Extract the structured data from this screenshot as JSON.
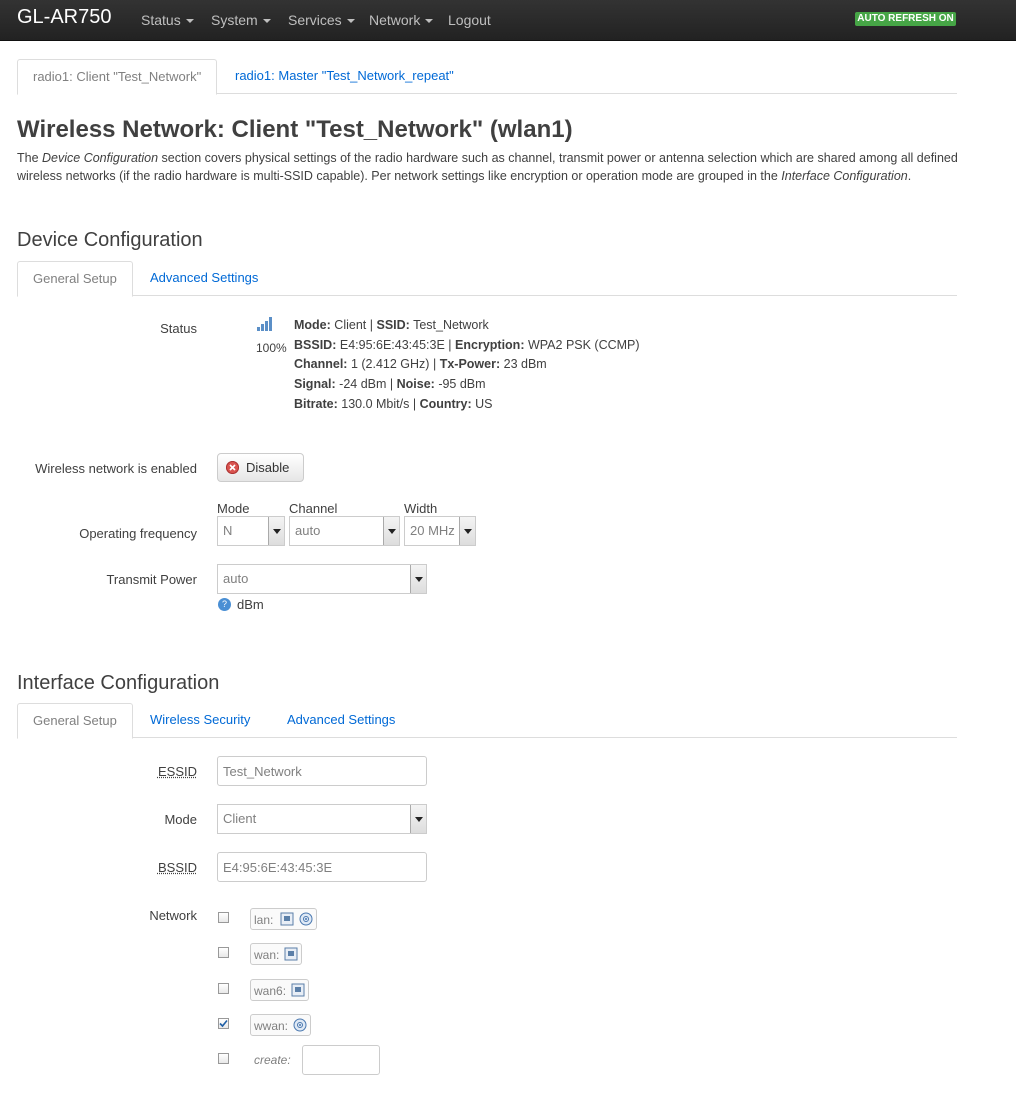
{
  "navbar": {
    "brand": "GL-AR750",
    "menu": [
      "Status",
      "System",
      "Services",
      "Network"
    ],
    "logout": "Logout",
    "auto_refresh": "AUTO REFRESH ON"
  },
  "top_tabs": [
    "radio1: Client \"Test_Network\"",
    "radio1: Master \"Test_Network_repeat\""
  ],
  "page": {
    "title": "Wireless Network: Client \"Test_Network\" (wlan1)",
    "desc_1": "The ",
    "desc_em1": "Device Configuration",
    "desc_2": " section covers physical settings of the radio hardware such as channel, transmit power or antenna selection which are shared among all defined wireless networks (if the radio hardware is multi-SSID capable). Per network settings like encryption or operation mode are grouped in the ",
    "desc_em2": "Interface Configuration",
    "desc_3": "."
  },
  "device_config": {
    "heading": "Device Configuration",
    "tabs": [
      "General Setup",
      "Advanced Settings"
    ],
    "status_label": "Status",
    "signal_percent": "100%",
    "status": {
      "mode_k": "Mode:",
      "mode_v": "Client",
      "ssid_k": "SSID:",
      "ssid_v": "Test_Network",
      "bssid_k": "BSSID:",
      "bssid_v": "E4:95:6E:43:45:3E",
      "enc_k": "Encryption:",
      "enc_v": "WPA2 PSK (CCMP)",
      "chan_k": "Channel:",
      "chan_v": "1 (2.412 GHz)",
      "txp_k": "Tx-Power:",
      "txp_v": "23 dBm",
      "sig_k": "Signal:",
      "sig_v": "-24 dBm",
      "noise_k": "Noise:",
      "noise_v": "-95 dBm",
      "bit_k": "Bitrate:",
      "bit_v": "130.0 Mbit/s",
      "country_k": "Country:",
      "country_v": "US",
      "sep": "|"
    },
    "enabled_label": "Wireless network is enabled",
    "disable_button": "Disable",
    "freq_label": "Operating frequency",
    "mode_label": "Mode",
    "mode_value": "N",
    "channel_label": "Channel",
    "channel_value": "auto",
    "width_label": "Width",
    "width_value": "20 MHz",
    "txpower_label": "Transmit Power",
    "txpower_value": "auto",
    "txpower_unit": "dBm"
  },
  "iface_config": {
    "heading": "Interface Configuration",
    "tabs": [
      "General Setup",
      "Wireless Security",
      "Advanced Settings"
    ],
    "essid_label": "ESSID",
    "essid_value": "Test_Network",
    "mode_label": "Mode",
    "mode_value": "Client",
    "bssid_label": "BSSID",
    "bssid_value": "E4:95:6E:43:45:3E",
    "network_label": "Network",
    "networks": [
      {
        "name": "lan:",
        "checked": false
      },
      {
        "name": "wan:",
        "checked": false
      },
      {
        "name": "wan6:",
        "checked": false
      },
      {
        "name": "wwan:",
        "checked": true
      }
    ],
    "create_label": "create:"
  }
}
